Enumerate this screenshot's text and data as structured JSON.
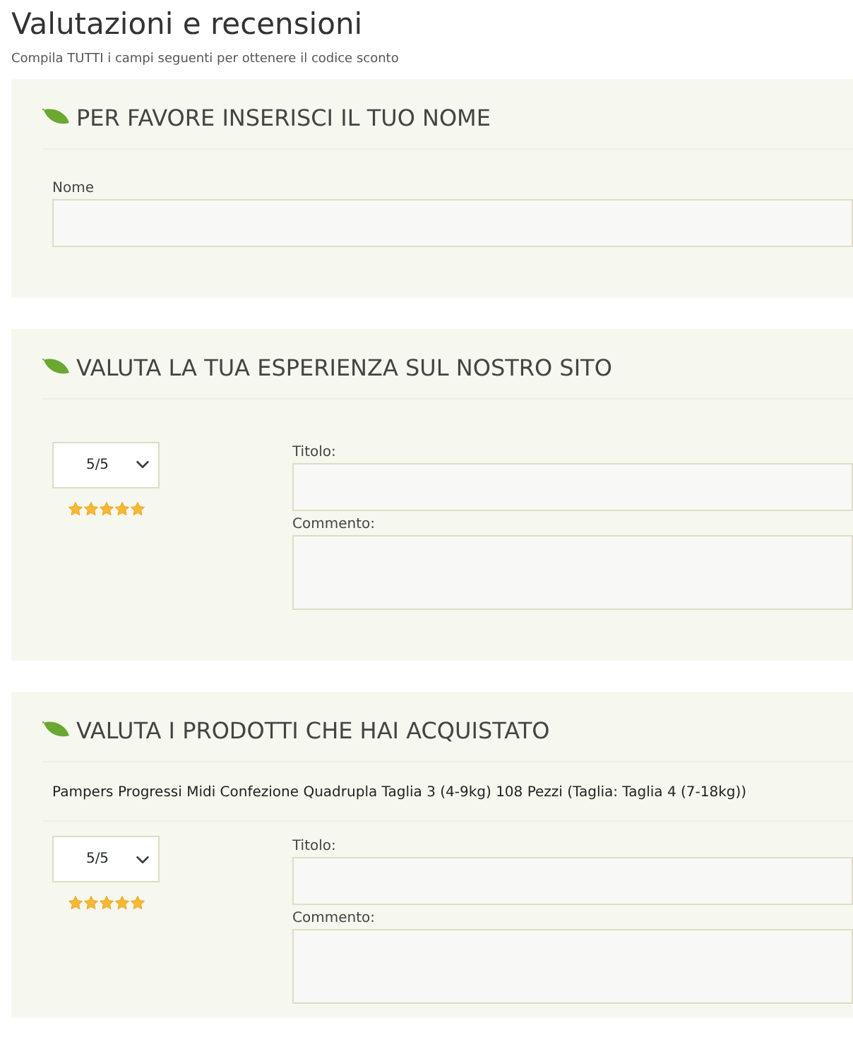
{
  "title": "Valutazioni e recensioni",
  "subtitle": "Compila TUTTI i campi seguenti per ottenere il codice sconto",
  "sections": [
    {
      "kind": "name",
      "heading": "PER FAVORE INSERISCI IL TUO NOME",
      "fields": [
        {
          "label": "Nome",
          "kind": "input"
        }
      ]
    },
    {
      "kind": "review",
      "heading": "VALUTA LA TUA ESPERIENZA SUL NOSTRO SITO",
      "rating": {
        "value": "5/5",
        "stars": 5
      },
      "fields": [
        {
          "label": "Titolo:",
          "kind": "input"
        },
        {
          "label": "Commento:",
          "kind": "textarea"
        }
      ]
    },
    {
      "kind": "review",
      "heading": "VALUTA I PRODOTTI CHE HAI ACQUISTATO",
      "product": "Pampers Progressi Midi Confezione Quadrupla Taglia 3 (4-9kg) 108 Pezzi (Taglia: Taglia 4 (7-18kg))",
      "rating": {
        "value": "5/5",
        "stars": 5
      },
      "fields": [
        {
          "label": "Titolo:",
          "kind": "input"
        },
        {
          "label": "Commento:",
          "kind": "textarea"
        }
      ]
    }
  ]
}
